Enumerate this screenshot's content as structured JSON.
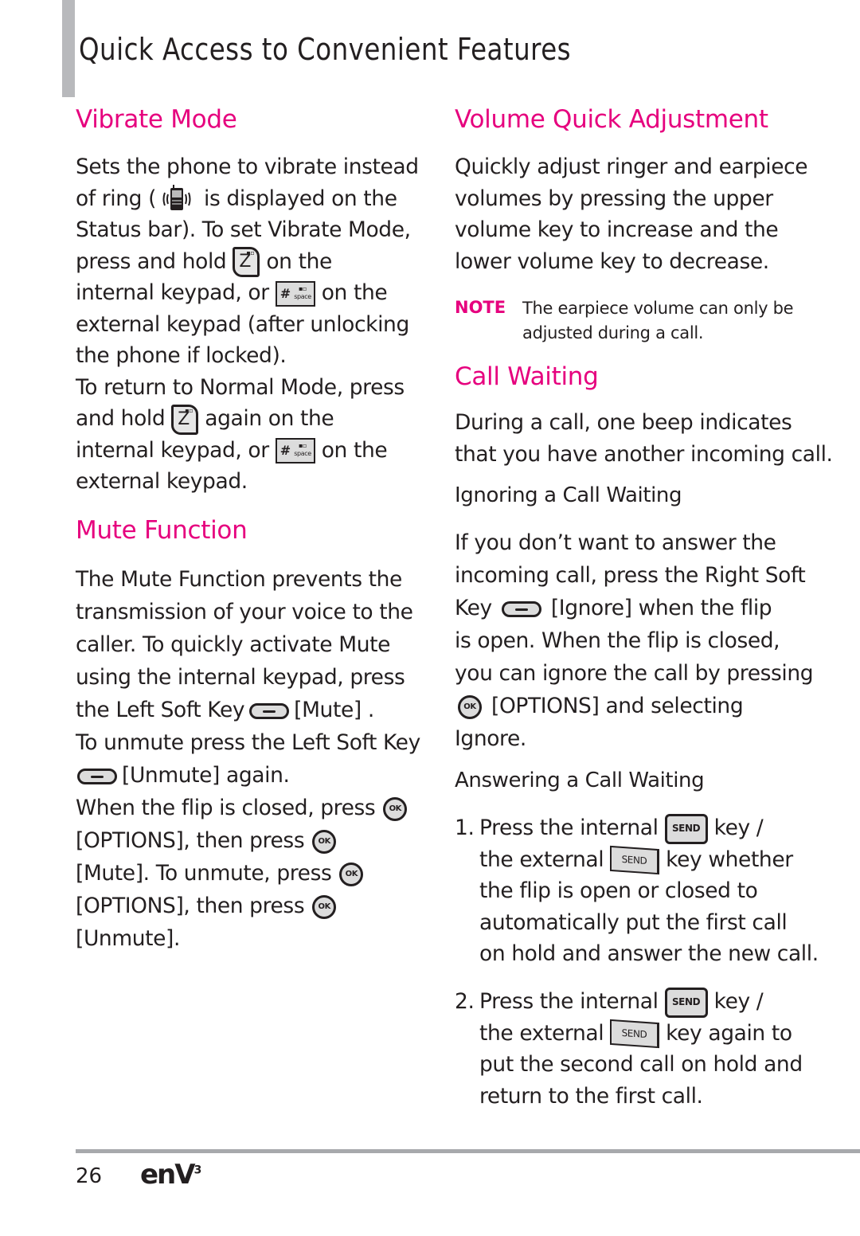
{
  "page": {
    "title": "Quick Access to Convenient Features",
    "page_number": "26",
    "brand_logo": "enV",
    "brand_logo_sup": "3"
  },
  "vibrate_mode": {
    "heading": "Vibrate Mode",
    "lines": [
      "Sets the phone to vibrate instead",
      "of ring (",
      " is displayed on the",
      "Status bar). To set Vibrate Mode,",
      "press and hold",
      "on the",
      "internal keypad, or",
      "on the",
      "external keypad (after unlocking",
      "the phone if locked).",
      "To return to Normal Mode, press",
      "and hold",
      "again on the",
      "internal keypad, or",
      "on the",
      "external keypad."
    ]
  },
  "mute_function": {
    "heading": "Mute Function",
    "lines": [
      "The Mute Function prevents the",
      "transmission of your voice to the",
      "caller. To quickly activate Mute",
      "using the internal keypad, press",
      "the Left Soft Key",
      "[Mute]",
      " .",
      "To unmute press the Left Soft Key",
      "[Unmute]",
      " again.",
      "When the flip is closed, press",
      "[OPTIONS]",
      ", then press",
      "[Mute]",
      ". To unmute, press",
      "[OPTIONS]",
      ", then press",
      "[Unmute]",
      "."
    ]
  },
  "volume_quick_adjustment": {
    "heading": "Volume Quick Adjustment",
    "lines": [
      "Quickly adjust ringer and earpiece",
      "volumes by pressing the upper",
      "volume key to increase and the",
      "lower volume key to decrease."
    ],
    "note_label": "NOTE",
    "note_lines": [
      "The earpiece volume can only be",
      "adjusted during a call."
    ]
  },
  "call_waiting": {
    "heading": "Call Waiting",
    "intro_lines": [
      "During a call, one beep indicates",
      "that you have another incoming call."
    ],
    "ignoring": {
      "subheading": "Ignoring a Call Waiting",
      "lines": [
        "If you don’t want to answer the",
        "incoming call, press the Right Soft",
        "Key",
        "[Ignore]",
        " when the flip",
        "is open. When the flip is closed,",
        "you can ignore the call by pressing",
        "[OPTIONS]",
        " and selecting",
        "Ignore."
      ]
    },
    "answering": {
      "subheading": "Answering a Call Waiting",
      "steps": [
        {
          "num": "1.",
          "lines": [
            "Press the internal",
            "key /",
            "the external",
            "key whether",
            "the flip is open or closed to",
            "automatically put the first call",
            "on hold and answer the new call."
          ]
        },
        {
          "num": "2.",
          "lines": [
            "Press the internal",
            "key /",
            "the external",
            "key again to",
            "put the second call on hold and",
            "return to the first call."
          ]
        }
      ]
    }
  },
  "icons": {
    "ok_key_label": "OK",
    "send_key_label": "SEND",
    "z_key_label": "Z",
    "hash_key_label": "#",
    "hash_key_sub": "space"
  },
  "colors": {
    "accent": "#e6007e",
    "text": "#231f20",
    "rule": "#a7a9ac",
    "sidebar_bar": "#b8b9bc"
  }
}
